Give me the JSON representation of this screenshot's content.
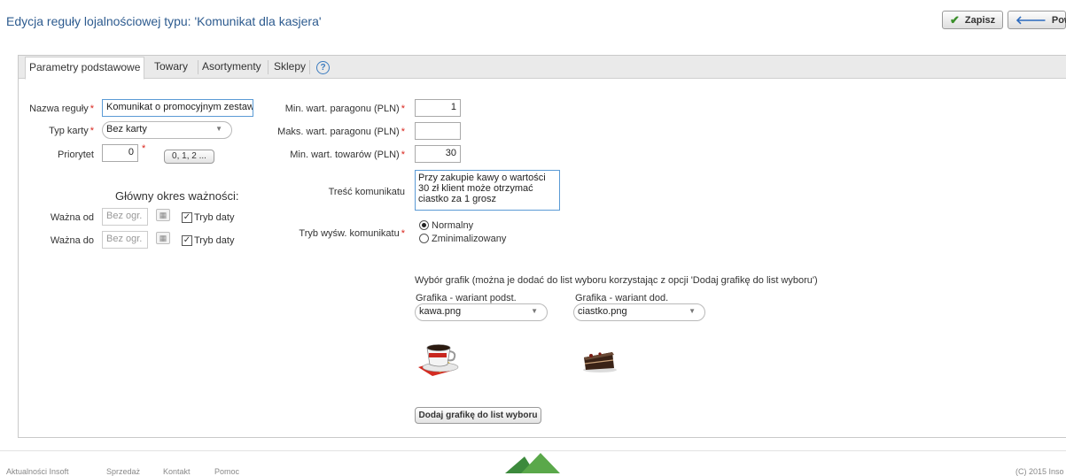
{
  "page": {
    "title": "Edycja reguły lojalnościowej typu: 'Komunikat dla kasjera'"
  },
  "header_buttons": {
    "save": "Zapisz",
    "back": "Powrót"
  },
  "tabs": [
    "Parametry podstawowe",
    "Towary",
    "Asortymenty",
    "Sklepy"
  ],
  "form": {
    "rule_name": {
      "label": "Nazwa reguły",
      "value": "Komunikat o promocyjnym zestawie"
    },
    "card_type": {
      "label": "Typ karty",
      "value": "Bez karty"
    },
    "priority": {
      "label": "Priorytet",
      "value": "0",
      "button": "0, 1, 2 ..."
    },
    "validity_title": "Główny okres ważności:",
    "valid_from": {
      "label": "Ważna od",
      "placeholder": "Bez ogr.",
      "checkbox": "Tryb daty",
      "checked": true
    },
    "valid_to": {
      "label": "Ważna do",
      "placeholder": "Bez ogr.",
      "checkbox": "Tryb daty",
      "checked": true
    },
    "min_receipt": {
      "label": "Min. wart. paragonu (PLN)",
      "value": "1"
    },
    "max_receipt": {
      "label": "Maks. wart. paragonu (PLN)",
      "value": ""
    },
    "min_goods": {
      "label": "Min. wart. towarów (PLN)",
      "value": "30"
    },
    "message": {
      "label": "Treść komunikatu",
      "value": "Przy zakupie kawy o wartości  30 zł klient może otrzymać ciastko za 1 grosz"
    },
    "display_mode": {
      "label": "Tryb wyśw. komunikatu",
      "options": [
        "Normalny",
        "Zminimalizowany"
      ],
      "selected": "Normalny"
    },
    "graphics_info": "Wybór grafik (można je dodać do list wyboru korzystając z opcji 'Dodaj grafikę do list wyboru')",
    "graphic_base": {
      "label": "Grafika - wariant podst.",
      "value": "kawa.png"
    },
    "graphic_extra": {
      "label": "Grafika - wariant dod.",
      "value": "ciastko.png"
    },
    "add_graphic_button": "Dodaj grafikę do list wyboru"
  },
  "footer": {
    "links": [
      "Aktualności Insoft",
      "Sprzedaż",
      "Kontakt",
      "Pomoc"
    ],
    "copyright": "(C) 2015 Inso"
  },
  "colors": {
    "title": "#2d5b8f",
    "required": "#d9271e",
    "save_check": "#3a8f2a",
    "back_arrow": "#2d6bbf"
  }
}
